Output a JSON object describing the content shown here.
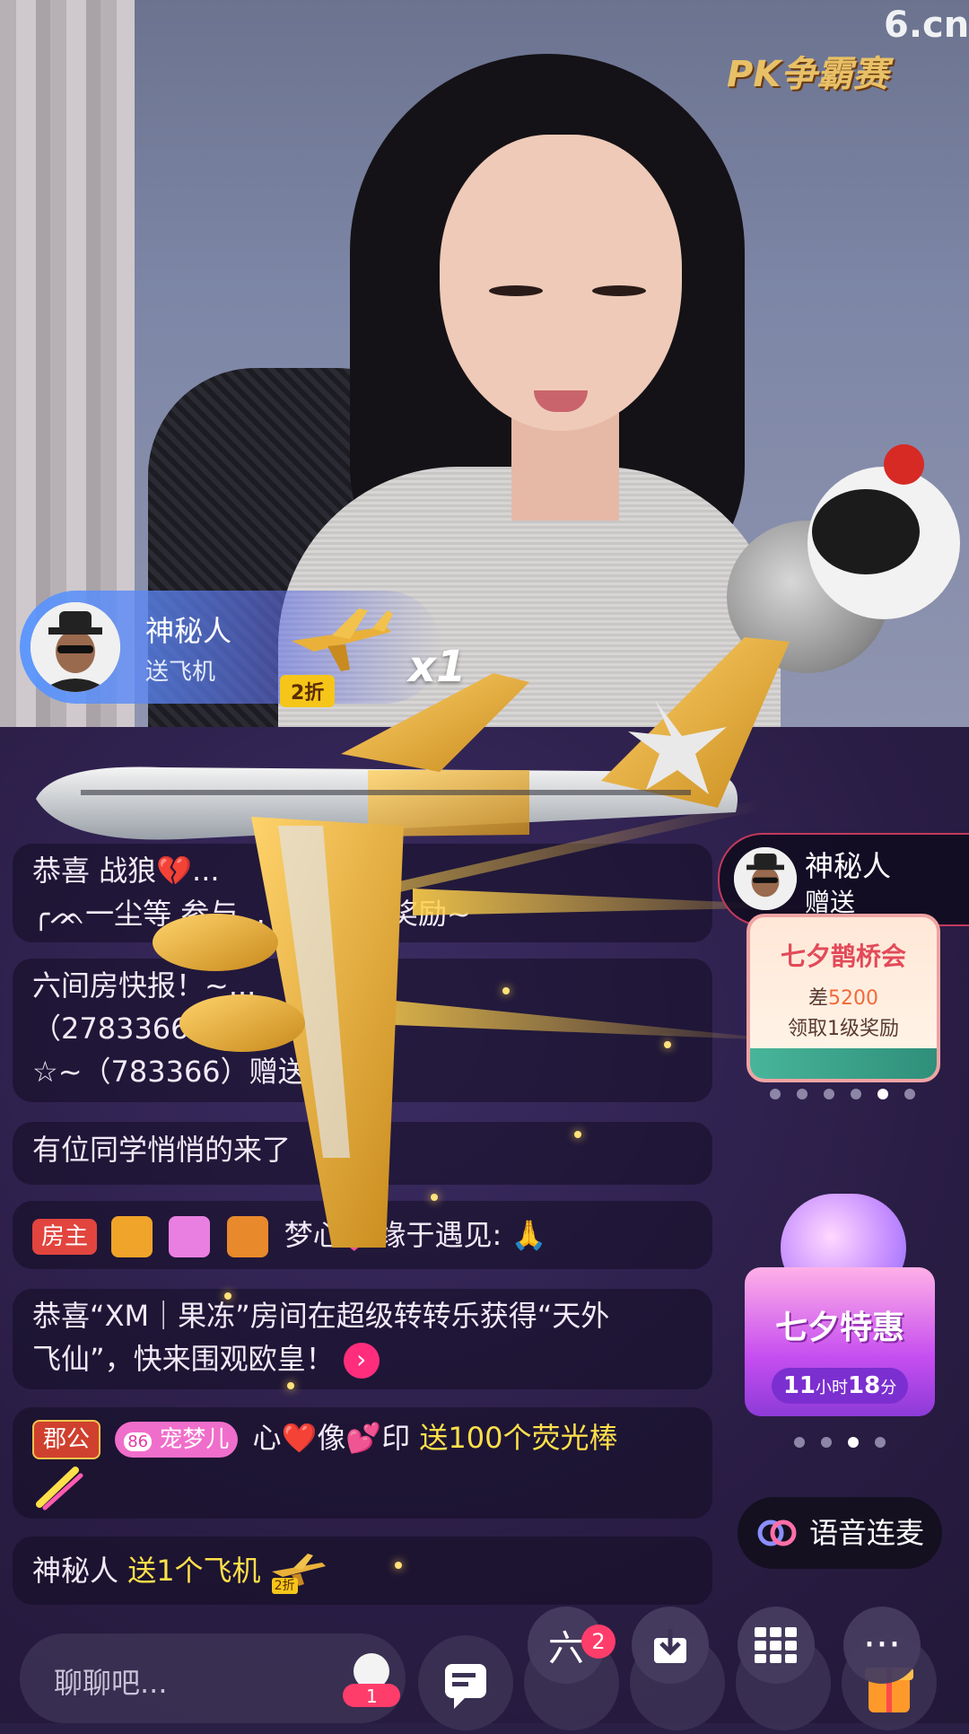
{
  "stream": {
    "site_logo": "6.cn",
    "pk_logo": "PK争霸赛"
  },
  "gift_banner": {
    "sender": "神秘人",
    "action": "送飞机",
    "discount": "2折",
    "count": "x1"
  },
  "chat": {
    "messages": [
      {
        "text": "恭喜 战狼💔..."
      },
      {
        "text": "╭ᨏ一尘等 参与... 方天画戟奖励~"
      },
      {
        "text": "六间房快报！~..."
      },
      {
        "text": "（2783366...谢有你"
      },
      {
        "text": "☆~（783366）赠送..."
      },
      {
        "text": "有位同学悄悄的来了"
      },
      {
        "role_badge": "房主",
        "user": "梦心💞缘于遇见:",
        "emoji": "🙏"
      },
      {
        "line1": "恭喜“XM｜果冻”房间在超级转转乐获得“天外",
        "line2": "飞仙”，快来围观欧皇！"
      },
      {
        "role_badge": "郡公",
        "level": "86",
        "level_name": "宠梦儿",
        "user": "心❤️像💕印",
        "gift": "送100个荧光棒"
      },
      {
        "user": "神秘人",
        "gift": "送1个飞机",
        "discount": "2折"
      }
    ]
  },
  "sidebar": {
    "sender_name": "神秘人",
    "sender_action": "赠送",
    "event_title": "七夕鹊桥会",
    "event_gap_prefix": "差",
    "event_gap_value": "5200",
    "event_reward": "领取1级奖励",
    "event_dots": 6,
    "event_active_dot": 4,
    "promo_title": "七夕特惠",
    "promo_hours": "11",
    "promo_hours_unit": "小时",
    "promo_minutes": "18",
    "promo_minutes_unit": "分",
    "promo_dots": 4,
    "promo_active_dot": 2,
    "voice_link_label": "语音连麦"
  },
  "bottom": {
    "input_placeholder": "聊聊吧...",
    "mini_badge": "1",
    "fab_notif": "2"
  },
  "colors": {
    "highlight_text": "#ffe04a",
    "accent_pink": "#ff2d7c"
  }
}
